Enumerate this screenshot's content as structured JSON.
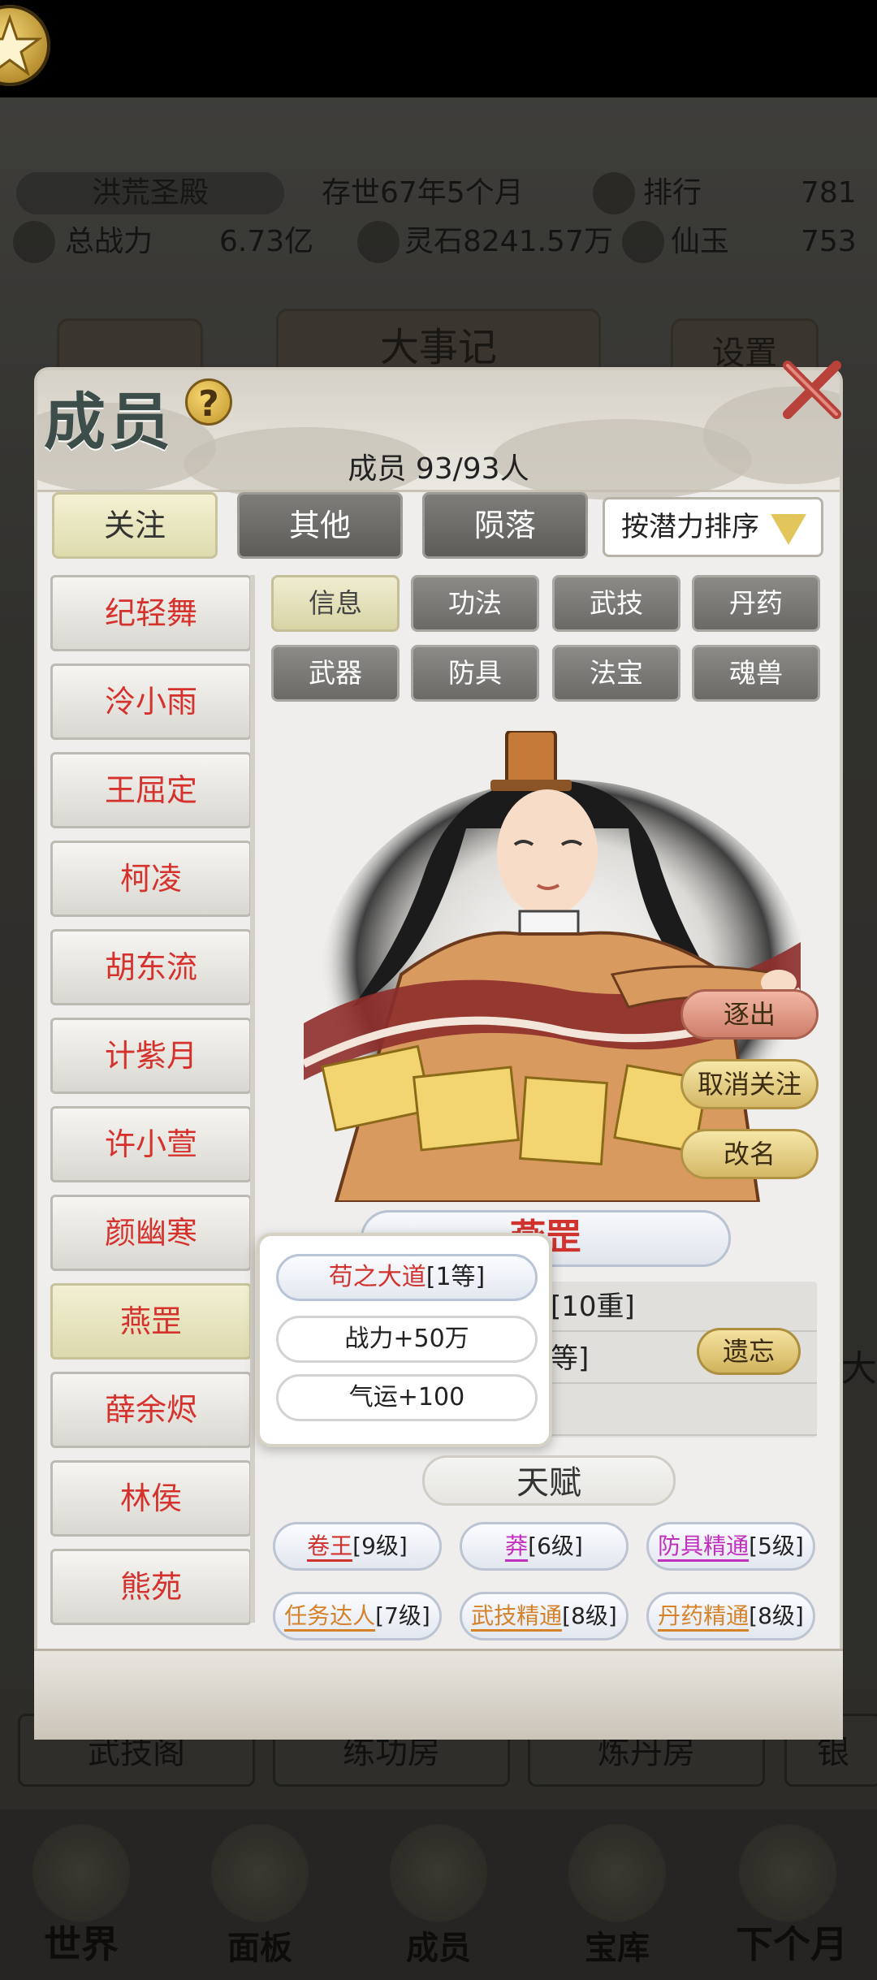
{
  "background": {
    "palace_name": "洪荒圣殿",
    "existence": "存世67年5个月",
    "rank_label": "排行",
    "rank_value": "781",
    "power_label": "总战力",
    "power_value": "6.73亿",
    "spirit_stone": "灵石8241.57万",
    "jade_label": "仙玉",
    "jade_value": "753",
    "events_button": "大事记",
    "settings_button": "设置",
    "rooms": [
      "武技阁",
      "练功房",
      "炼丹房"
    ],
    "side_char": "大",
    "side_char2": "银"
  },
  "bottom_nav": [
    "世界",
    "面板",
    "成员",
    "宝库",
    "下个月"
  ],
  "modal": {
    "title": "成员",
    "help": "?",
    "member_count": "成员 93/93人",
    "tabs": [
      "关注",
      "其他",
      "陨落"
    ],
    "sort": "按潜力排序",
    "members": [
      "纪轻舞",
      "泠小雨",
      "王屈定",
      "柯凌",
      "胡东流",
      "计紫月",
      "许小萱",
      "颜幽寒",
      "燕罡",
      "薛余烬",
      "林侯",
      "熊苑"
    ],
    "selected_member": "燕罡",
    "categories_row1": [
      "信息",
      "功法",
      "武技",
      "丹药"
    ],
    "categories_row2": [
      "武器",
      "防具",
      "法宝",
      "魂兽"
    ],
    "actions": [
      "逐出",
      "取消关注",
      "改名"
    ],
    "character_name": "燕罡",
    "info_rows": [
      "[10重]",
      "等]",
      ""
    ],
    "forget_button": "遗忘",
    "popup": {
      "skill_name": "苟之大道",
      "skill_level": "[1等]",
      "line2": "战力+50万",
      "line3": "气运+100"
    },
    "talent_title": "天赋",
    "talents": [
      {
        "name": "卷王",
        "level": "[9级]"
      },
      {
        "name": "莽",
        "level": "[6级]"
      },
      {
        "name": "防具精通",
        "level": "[5级]"
      },
      {
        "name": "任务达人",
        "level": "[7级]"
      },
      {
        "name": "武技精通",
        "level": "[8级]"
      },
      {
        "name": "丹药精通",
        "level": "[8级]"
      }
    ]
  },
  "colors": {
    "accent_red": "#d0322d",
    "talent_magenta": "#c22fbf",
    "talent_orange": "#d6822a"
  }
}
